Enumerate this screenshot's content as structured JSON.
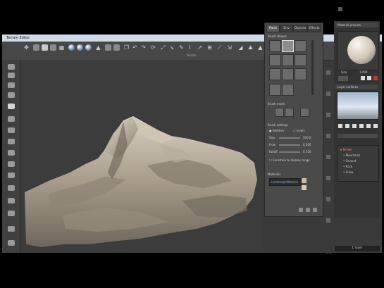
{
  "window": {
    "title": "Terrain Editor",
    "controls": [
      "–",
      "□",
      "✕"
    ]
  },
  "toolbar": {
    "group_label": "Terrain"
  },
  "right_panel": {
    "tabs": [
      "Paint",
      "Env",
      "Objects",
      "Effects"
    ],
    "brush_shapes_label": "Brush shapes",
    "brush_mode_label": "Brush mode",
    "brush_settings_label": "Brush settings",
    "option_left": "Additive",
    "option_right": "Invert",
    "settings": [
      {
        "label": "Size",
        "value": "500.0"
      },
      {
        "label": "Flow",
        "value": "0.200"
      },
      {
        "label": "Falloff",
        "value": "0.750"
      }
    ],
    "checkbox_label": "Constrain to display range",
    "materials_label": "Materials",
    "material_name": "LandscapeMaterial"
  },
  "far_right": {
    "material_preview_title": "Material preview",
    "preview_info": "Size",
    "preview_value": "1.000",
    "layers_title": "Layer surfaces",
    "layers": [
      {
        "name": "Terrain",
        "highlight": true
      },
      {
        "name": "Mountains",
        "highlight": false
      },
      {
        "name": "Ground",
        "highlight": false
      },
      {
        "name": "Rock",
        "highlight": false
      },
      {
        "name": "Snow",
        "highlight": false
      }
    ],
    "status": "1 layer"
  }
}
